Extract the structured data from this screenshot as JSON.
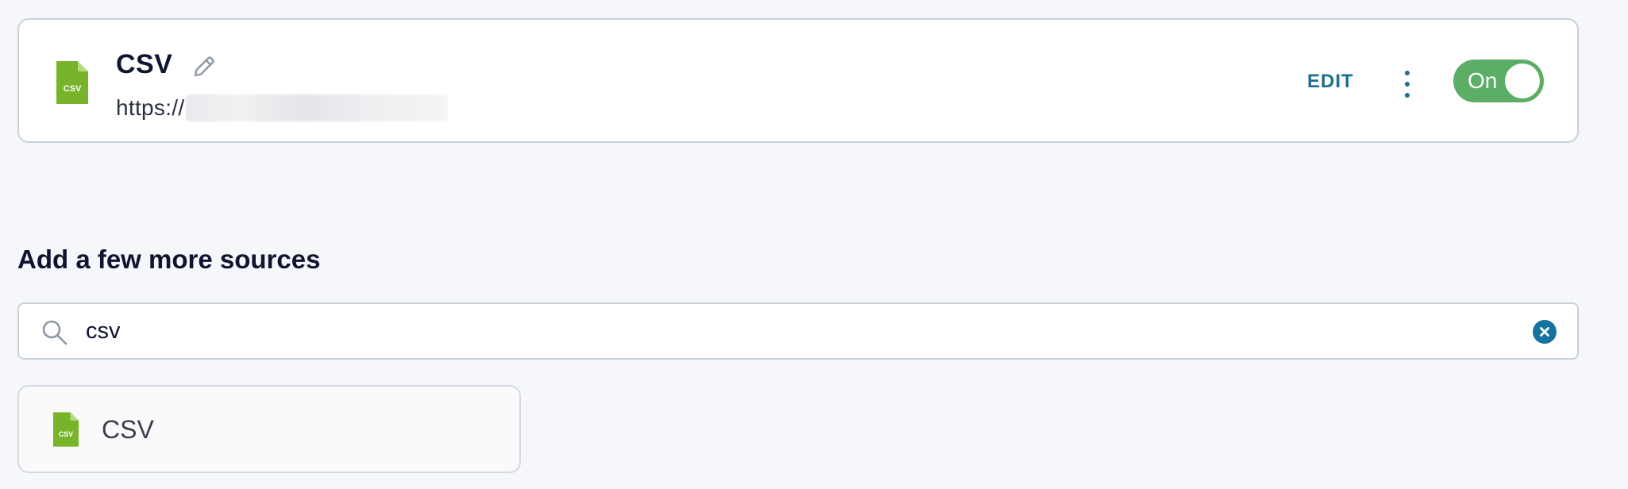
{
  "connected_source": {
    "icon": "csv-file-icon",
    "icon_text": "CSV",
    "title": "CSV",
    "url_prefix": "https://",
    "edit_label": "EDIT",
    "toggle_label": "On",
    "toggle_on": true
  },
  "add_sources": {
    "heading": "Add a few more sources",
    "search_value": "csv",
    "results": [
      {
        "label": "CSV",
        "icon": "csv-file-icon",
        "icon_text": "CSV"
      }
    ]
  },
  "colors": {
    "background": "#f6f7fa",
    "accent": "#1d6f8f",
    "toggle_on": "#5cae66",
    "csv_icon": "#77b42a",
    "clear_button": "#1673a0"
  }
}
